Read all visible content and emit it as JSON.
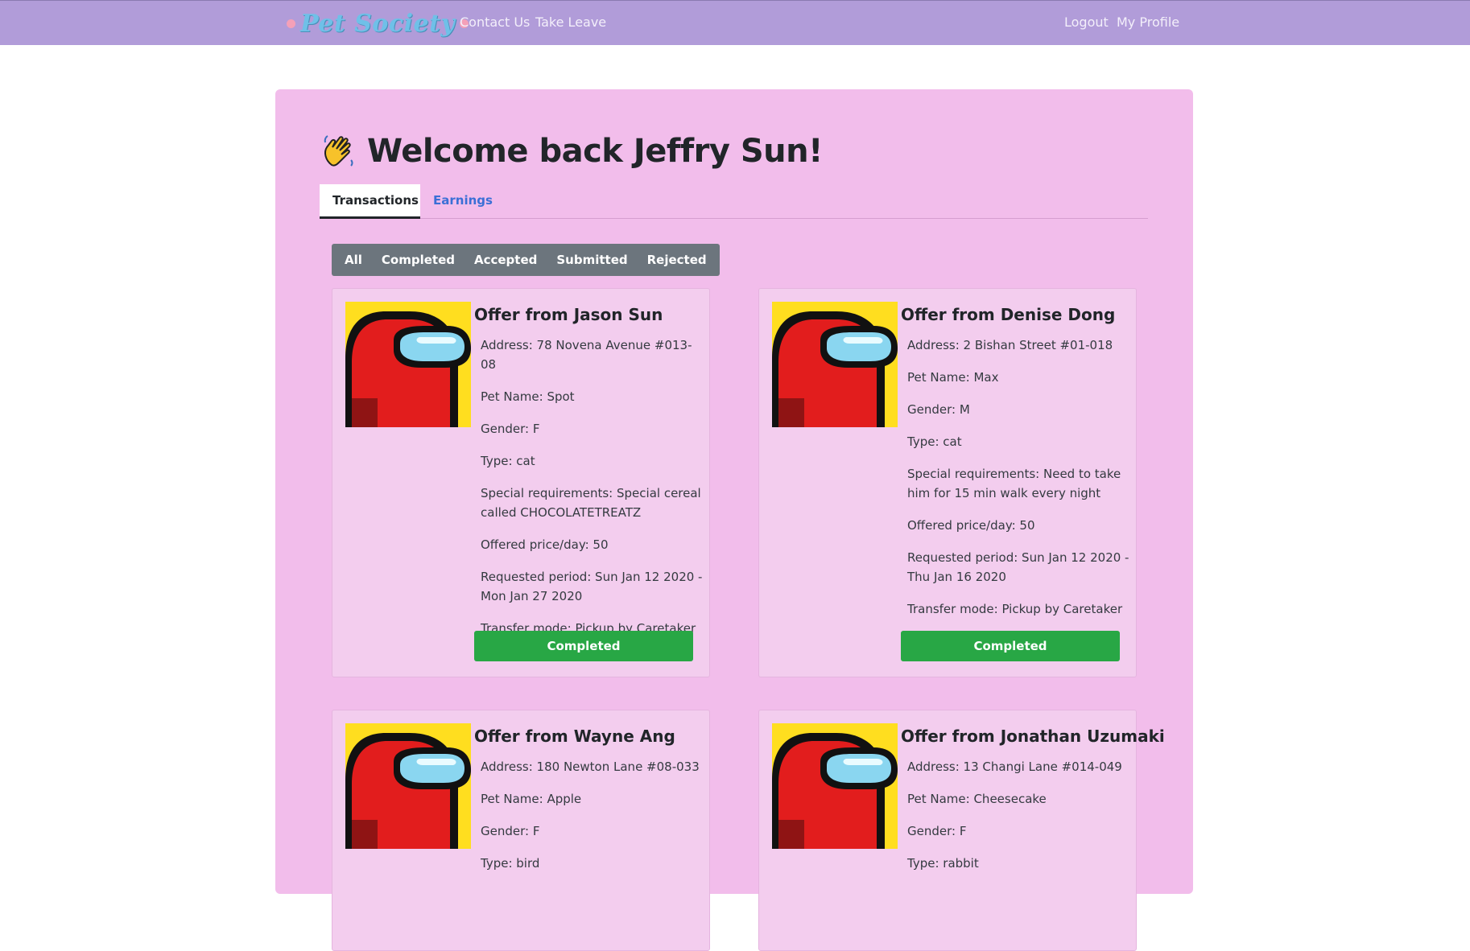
{
  "nav": {
    "brand": "Pet Society",
    "links": [
      "Contact Us",
      "Take Leave"
    ],
    "right_links": [
      "Logout",
      "My Profile"
    ]
  },
  "welcome": {
    "title": "Welcome back Jeffry Sun!"
  },
  "tabs": [
    "Transactions",
    "Earnings"
  ],
  "filters": [
    "All",
    "Completed",
    "Accepted",
    "Submitted",
    "Rejected"
  ],
  "offers": [
    {
      "title": "Offer from Jason Sun",
      "address": "Address: 78 Novena Avenue #013-08",
      "pet_name": "Pet Name: Spot",
      "gender": "Gender: F",
      "type": "Type: cat",
      "special": "Special requirements: Special cereal called CHOCOLATETREATZ",
      "price": "Offered price/day: 50",
      "period": "Requested period: Sun Jan 12 2020 - Mon Jan 27 2020",
      "transfer": "Transfer mode: Pickup by Caretaker",
      "status": "Completed"
    },
    {
      "title": "Offer from Denise Dong",
      "address": "Address: 2 Bishan Street #01-018",
      "pet_name": "Pet Name: Max",
      "gender": "Gender: M",
      "type": "Type: cat",
      "special": "Special requirements: Need to take him for 15 min walk every night",
      "price": "Offered price/day: 50",
      "period": "Requested period: Sun Jan 12 2020 - Thu Jan 16 2020",
      "transfer": "Transfer mode: Pickup by Caretaker",
      "status": "Completed"
    },
    {
      "title": "Offer from Wayne Ang",
      "address": "Address: 180 Newton Lane #08-033",
      "pet_name": "Pet Name: Apple",
      "gender": "Gender: F",
      "type": "Type: bird"
    },
    {
      "title": "Offer from Jonathan Uzumaki",
      "address": "Address: 13 Changi Lane #014-049",
      "pet_name": "Pet Name: Cheesecake",
      "gender": "Gender: F",
      "type": "Type: rabbit"
    }
  ],
  "colors": {
    "navbar": "#b19cd9",
    "panel": "#f2bdeb",
    "card": "#f3cdee",
    "completed": "#28a745",
    "filter_bg": "#6c757d",
    "link_active": "#3b6fd6"
  },
  "icons": {
    "wave": "waving-hand-icon",
    "avatar": "among-us-crewmate-avatar"
  }
}
